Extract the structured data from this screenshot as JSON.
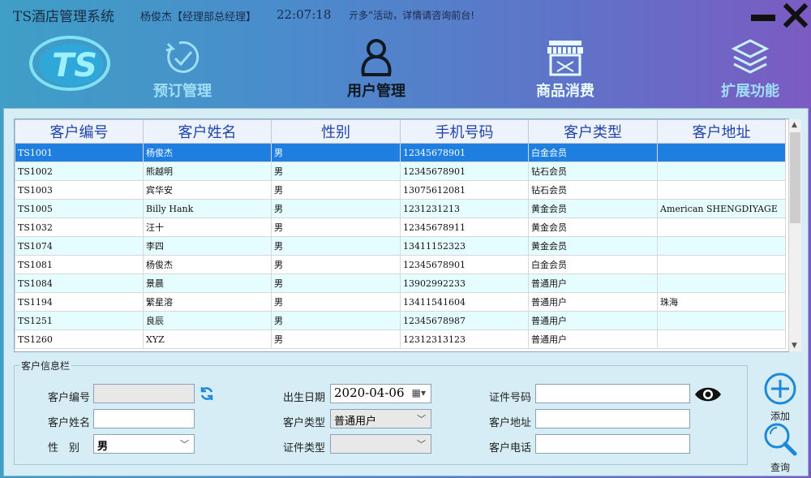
{
  "window": {
    "title": "TS酒店管理系统",
    "user_info": "杨俊杰【经理部总经理】",
    "clock": "22:07:18",
    "marquee": "亓多”活动，详情请咨询前台!"
  },
  "logo_text": "TS",
  "nav": [
    {
      "label": "预订管理",
      "icon": "check-circle-icon",
      "state": "inactive"
    },
    {
      "label": "用户管理",
      "icon": "person-icon",
      "state": "active"
    },
    {
      "label": "商品消费",
      "icon": "store-icon",
      "state": "bright"
    },
    {
      "label": "扩展功能",
      "icon": "layers-icon",
      "state": "inactive"
    }
  ],
  "table": {
    "columns": [
      "客户编号",
      "客户姓名",
      "性别",
      "手机号码",
      "客户类型",
      "客户地址"
    ],
    "rows": [
      [
        "TS1001",
        "杨俊杰",
        "男",
        "12345678901",
        "白金会员",
        ""
      ],
      [
        "TS1002",
        "熊越明",
        "男",
        "12345678901",
        "钻石会员",
        ""
      ],
      [
        "TS1003",
        "宾华安",
        "男",
        "13075612081",
        "钻石会员",
        ""
      ],
      [
        "TS1005",
        "Billy Hank",
        "男",
        "1231231213",
        "黄金会员",
        "American SHENGDIYAGE"
      ],
      [
        "TS1032",
        "汪十",
        "男",
        "12345678911",
        "黄金会员",
        ""
      ],
      [
        "TS1074",
        "李四",
        "男",
        "13411152323",
        "黄金会员",
        ""
      ],
      [
        "TS1081",
        "杨俊杰",
        "男",
        "12345678901",
        "白金会员",
        ""
      ],
      [
        "TS1084",
        "景晨",
        "男",
        "13902992233",
        "普通用户",
        ""
      ],
      [
        "TS1194",
        "繁星溶",
        "男",
        "13411541604",
        "普通用户",
        "珠海"
      ],
      [
        "TS1251",
        "良辰",
        "男",
        "12345678987",
        "普通用户",
        ""
      ],
      [
        "TS1260",
        "XYZ",
        "男",
        "12312313123",
        "普通用户",
        ""
      ]
    ],
    "selected_row": 0
  },
  "info": {
    "legend": "客户信息栏",
    "labels": {
      "customer_id": "客户编号",
      "customer_name": "客户姓名",
      "gender": "性　别",
      "birth_date": "出生日期",
      "customer_type": "客户类型",
      "id_type": "证件类型",
      "id_number": "证件号码",
      "address": "客户地址",
      "phone": "客户电话"
    },
    "values": {
      "gender": "男",
      "birth_date": "2020-04-06",
      "customer_type": "普通用户"
    }
  },
  "actions": {
    "add": "添加",
    "query": "查询"
  },
  "colors": {
    "selected_row": "#1e7fe0",
    "alt_row": "#e6fdff",
    "header_text": "#2244aa"
  }
}
